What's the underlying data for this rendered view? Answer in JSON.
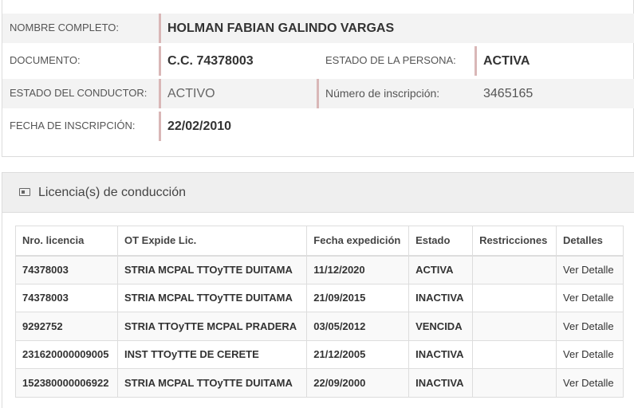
{
  "person": {
    "nombre_label": "NOMBRE COMPLETO:",
    "nombre_value": "HOLMAN FABIAN GALINDO VARGAS",
    "documento_label": "DOCUMENTO:",
    "documento_value": "C.C. 74378003",
    "estado_persona_label": "ESTADO DE LA PERSONA:",
    "estado_persona_value": "ACTIVA",
    "estado_conductor_label": "ESTADO DEL CONDUCTOR:",
    "estado_conductor_value": "ACTIVO",
    "inscripcion_num_label": "Número de inscripción:",
    "inscripcion_num_value": "3465165",
    "fecha_inscripcion_label": "FECHA DE INSCRIPCIÓN:",
    "fecha_inscripcion_value": "22/02/2010"
  },
  "licenses": {
    "title": "Licencia(s) de conducción",
    "icon": "id-card-icon",
    "columns": [
      "Nro. licencia",
      "OT Expide Lic.",
      "Fecha expedición",
      "Estado",
      "Restricciones",
      "Detalles"
    ],
    "rows": [
      {
        "nro": "74378003",
        "ot": "STRIA MCPAL TTOyTTE DUITAMA",
        "fecha": "11/12/2020",
        "estado": "ACTIVA",
        "restricciones": "",
        "detalles": "Ver Detalle"
      },
      {
        "nro": "74378003",
        "ot": "STRIA MCPAL TTOyTTE DUITAMA",
        "fecha": "21/09/2015",
        "estado": "INACTIVA",
        "restricciones": "",
        "detalles": "Ver Detalle"
      },
      {
        "nro": "9292752",
        "ot": "STRIA TTOyTTE MCPAL PRADERA",
        "fecha": "03/05/2012",
        "estado": "VENCIDA",
        "restricciones": "",
        "detalles": "Ver Detalle"
      },
      {
        "nro": "231620000009005",
        "ot": "INST TTOyTTE DE CERETE",
        "fecha": "21/12/2005",
        "estado": "INACTIVA",
        "restricciones": "",
        "detalles": "Ver Detalle"
      },
      {
        "nro": "152380000006922",
        "ot": "STRIA MCPAL TTOyTTE DUITAMA",
        "fecha": "22/09/2000",
        "estado": "INACTIVA",
        "restricciones": "",
        "detalles": "Ver Detalle"
      }
    ]
  }
}
